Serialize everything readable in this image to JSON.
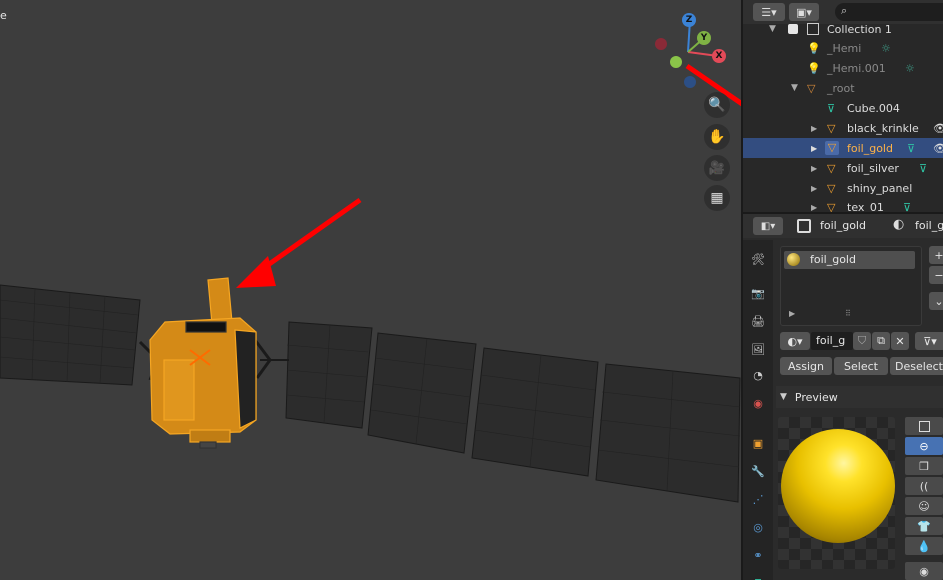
{
  "viewport": {
    "corner_text": "e",
    "nav_gizmo": {
      "x_label": "X",
      "y_label": "Y",
      "z_label": "Z"
    },
    "nav_buttons": [
      "zoom-icon",
      "hand-icon",
      "camera-icon",
      "grid-icon"
    ]
  },
  "outliner": {
    "rows": [
      {
        "label": "Collection 1",
        "icon": "collection-icon"
      },
      {
        "label": "_Hemi",
        "icon": "light-icon"
      },
      {
        "label": "_Hemi.001",
        "icon": "light-icon"
      },
      {
        "label": "_root",
        "icon": "mesh-icon"
      },
      {
        "label": "Cube.004",
        "icon": "mesh-data-icon"
      },
      {
        "label": "black_krinkle",
        "icon": "mesh-icon"
      },
      {
        "label": "foil_gold",
        "icon": "mesh-icon",
        "selected": true
      },
      {
        "label": "foil_silver",
        "icon": "mesh-icon"
      },
      {
        "label": "shiny_panel",
        "icon": "mesh-icon"
      },
      {
        "label": "tex_01",
        "icon": "mesh-icon"
      }
    ]
  },
  "properties": {
    "header_object": "foil_gold",
    "header_material": "foil_g",
    "material_slot": "foil_gold",
    "material_field": "foil_g",
    "buttons": {
      "assign": "Assign",
      "select": "Select",
      "deselect": "Deselect"
    },
    "preview_label": "Preview"
  },
  "colors": {
    "selection": "#334d80",
    "accent": "#4772b3",
    "object_orange": "#f5a623",
    "arrow": "#ff0000"
  }
}
